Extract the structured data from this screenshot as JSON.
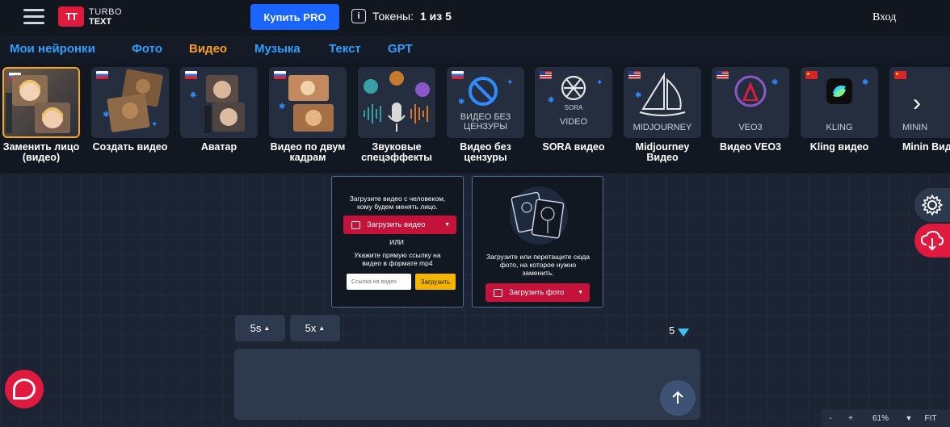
{
  "header": {
    "logo_mark": "TT",
    "logo_line1": "TURBO",
    "logo_line2": "TEXT",
    "pro_button": "Купить PRO",
    "tokens_label": "Токены:",
    "tokens_value": "1 из 5",
    "login": "Вход"
  },
  "nav": {
    "items": [
      {
        "label": "Мои нейронки"
      },
      {
        "label": "Фото"
      },
      {
        "label": "Видео"
      },
      {
        "label": "Музыка"
      },
      {
        "label": "Текст"
      },
      {
        "label": "GPT"
      }
    ],
    "active": "Видео"
  },
  "tools": [
    {
      "label": "Заменить лицо (видео)",
      "flag": "ru"
    },
    {
      "label": "Создать видео",
      "flag": "ru"
    },
    {
      "label": "Аватар",
      "flag": "ru"
    },
    {
      "label": "Видео по двум кадрам",
      "flag": "ru"
    },
    {
      "label": "Звуковые спецэффекты",
      "flag": "ru"
    },
    {
      "label": "Видео без цензуры",
      "flag": "ru",
      "caption": "ВИДЕО БЕЗ ЦЕНЗУРЫ"
    },
    {
      "label": "SORA видео",
      "flag": "us",
      "caption": "VIDEO",
      "sub": "SORA"
    },
    {
      "label": "Midjourney Видео",
      "flag": "us",
      "caption": "MIDJOURNEY"
    },
    {
      "label": "Видео VEO3",
      "flag": "us",
      "caption": "VEO3"
    },
    {
      "label": "Kling видео",
      "flag": "cn",
      "caption": "KLING"
    },
    {
      "label": "Minin Виде",
      "flag": "cn",
      "caption": "MININ"
    }
  ],
  "upload_video": {
    "hint": "Загрузите видео с человеком, кому будем менять лицо.",
    "button": "Загрузить видео",
    "or": "ИЛИ",
    "link_hint": "Укажите прямую ссылку на видео в формате mp4",
    "input_placeholder": "Ссылка на видео",
    "load_button": "Загрузить"
  },
  "upload_photo": {
    "hint": "Загрузите или перетащите сюда фото, на которое нужно заменить.",
    "button": "Загрузить фото"
  },
  "options": {
    "duration": "5s",
    "multiplier": "5x",
    "cost": "5"
  },
  "zoom": {
    "minus": "-",
    "plus": "+",
    "level": "61%",
    "fit": "FIT"
  },
  "colors": {
    "accent_red": "#e0193f",
    "accent_blue": "#1a64ff",
    "nav_blue": "#2f9fff",
    "nav_active": "#ff9d1e"
  }
}
